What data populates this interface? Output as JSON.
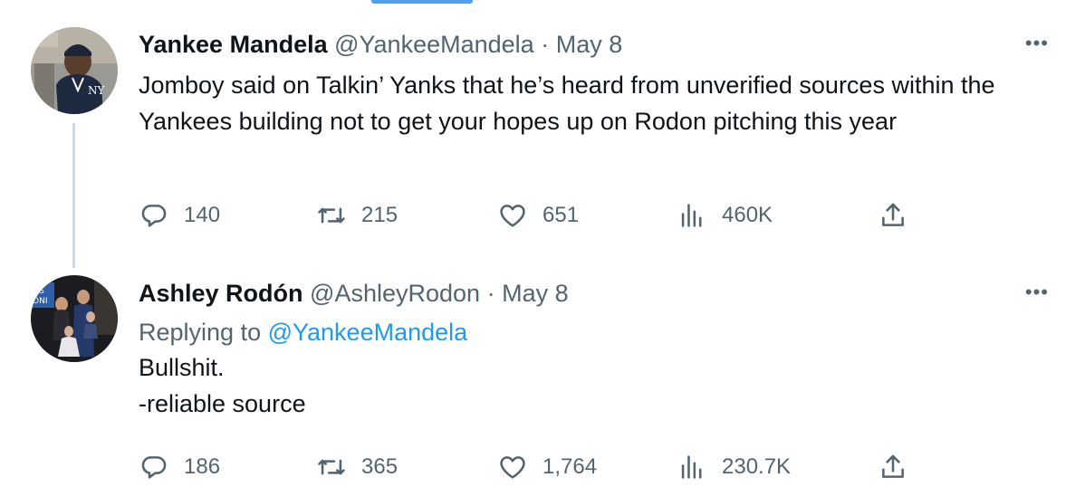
{
  "tweets": [
    {
      "name": "Yankee Mandela",
      "handle": "@YankeeMandela",
      "separator": "·",
      "date": "May 8",
      "text": "Jomboy said on Talkin’ Yanks that he’s heard from unverified sources within the Yankees building not to get your hopes up on Rodon pitching this year",
      "stats": {
        "replies": "140",
        "retweets": "215",
        "likes": "651",
        "views": "460K"
      },
      "more": "•••"
    },
    {
      "name": "Ashley Rodón",
      "handle": "@AshleyRodon",
      "separator": "·",
      "date": "May 8",
      "replying_label": "Replying to",
      "replying_handle": "@YankeeMandela",
      "text_lines": [
        "Bullshit.",
        "-reliable source"
      ],
      "stats": {
        "replies": "186",
        "retweets": "365",
        "likes": "1,764",
        "views": "230.7K"
      },
      "more": "•••"
    }
  ],
  "colors": {
    "text": "#0f1419",
    "secondary": "#536471",
    "link": "#1d9bf0",
    "thread_line": "#cfd9de"
  },
  "icons": [
    "reply-icon",
    "retweet-icon",
    "like-icon",
    "views-icon",
    "share-icon",
    "more-icon"
  ]
}
